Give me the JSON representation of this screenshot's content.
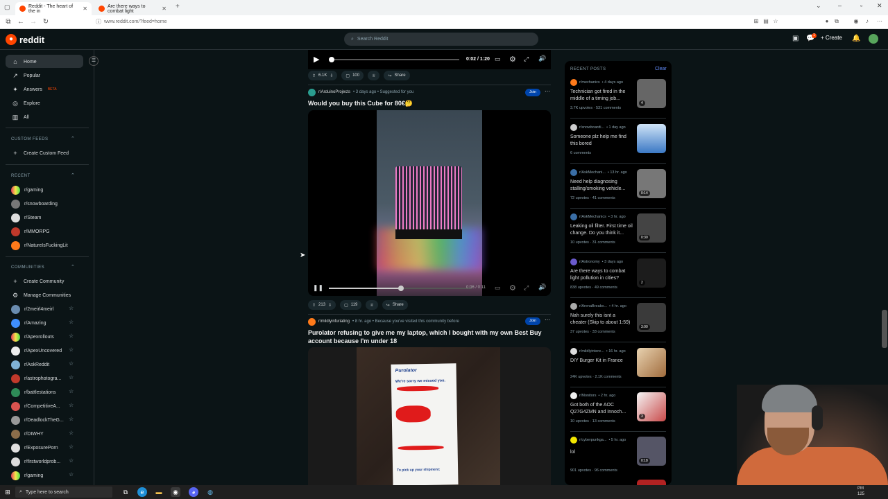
{
  "browser": {
    "tabs": [
      {
        "title": "Reddit - The heart of the in"
      },
      {
        "title": "Are there ways to combat light"
      }
    ],
    "url": "www.reddit.com/?feed=home"
  },
  "header": {
    "logo_text": "reddit",
    "search_placeholder": "Search Reddit",
    "create_label": "Create",
    "notification_count": "1"
  },
  "sidebar": {
    "nav": [
      "Home",
      "Popular",
      "Answers",
      "Explore",
      "All"
    ],
    "answers_badge": "BETA",
    "custom_feeds_heading": "CUSTOM FEEDS",
    "create_custom_feed": "Create Custom Feed",
    "recent_heading": "RECENT",
    "recent": [
      "r/gaming",
      "r/snowboarding",
      "r/Steam",
      "r/MMORPG",
      "r/NatureIsFuckingLit"
    ],
    "communities_heading": "COMMUNITIES",
    "create_community": "Create Community",
    "manage_communities": "Manage Communities",
    "communities": [
      "r/2meirl4meirl",
      "r/Amazing",
      "r/Apexrollouts",
      "r/ApexUncovered",
      "r/AskReddit",
      "r/astrophotogra...",
      "r/battlestations",
      "r/CompetitiveA...",
      "r/DeadlockTheG...",
      "r/DIWHY",
      "r/ExposurePorn",
      "r/firstworldprob...",
      "r/gaming"
    ]
  },
  "top_video": {
    "time": "0:02 / 1:20",
    "upvotes": "6.1K",
    "comments": "100",
    "share": "Share"
  },
  "post1": {
    "subreddit": "r/ArduinoProjects",
    "meta": "• 3 days ago • Suggested for you",
    "join": "Join",
    "title": "Would you buy this Cube for 80€🤔",
    "video_time": "0:06 / 0:11",
    "upvotes": "213",
    "comments": "119",
    "share": "Share"
  },
  "post2": {
    "subreddit": "r/mildlyinfuriating",
    "meta": "• 8 hr. ago • Because you've visited this community before",
    "join": "Join",
    "title": "Purolator refusing to give me my laptop, which I bought with my own Best Buy account because I'm under 18",
    "brand": "Purolator",
    "sorry": "We're sorry we missed you.",
    "pickup": "To pick up your shipment:"
  },
  "recent_posts": {
    "heading": "RECENT POSTS",
    "clear": "Clear",
    "items": [
      {
        "sub": "r/mechanics",
        "age": "• 4 days ago",
        "title": "Technician got fired in the middle of a timing job...",
        "stats": "3.7K upvotes · 531 comments",
        "badge": "4"
      },
      {
        "sub": "r/snowboardi...",
        "age": "• 1 day ago",
        "title": "Someone plz help me find this bored",
        "stats": "6 comments",
        "badge": ""
      },
      {
        "sub": "r/AskMechani...",
        "age": "• 13 hr. ago",
        "title": "Need help diagnosing stalling/smoking vehicle...",
        "stats": "72 upvotes · 41 comments",
        "badge": "0:14"
      },
      {
        "sub": "r/AskMechanics",
        "age": "• 3 hr. ago",
        "title": "Leaking oil filter. First time oil change. Do you think it...",
        "stats": "10 upvotes · 31 comments",
        "badge": "0:30"
      },
      {
        "sub": "r/Astronomy",
        "age": "• 3 days ago",
        "title": "Are there ways to combat light pollution in cities?",
        "stats": "838 upvotes · 49 comments",
        "badge": "2"
      },
      {
        "sub": "r/ArenaBreako...",
        "age": "• 4 hr. ago",
        "title": "Nah surely this isnt a cheater (Skip to about 1:59)",
        "stats": "37 upvotes · 33 comments",
        "badge": "3:00"
      },
      {
        "sub": "r/mildlyintere...",
        "age": "• 16 hr. ago",
        "title": "DIY Burger Kit in France",
        "stats": "24K upvotes · 2.1K comments",
        "badge": ""
      },
      {
        "sub": "r/Monitors",
        "age": "• 2 hr. ago",
        "title": "Got both of the AOC Q27G4ZMN and Innoch...",
        "stats": "10 upvotes · 13 comments",
        "badge": "3"
      },
      {
        "sub": "r/cyberpunkga...",
        "age": "• 5 hr. ago",
        "title": "lol",
        "stats": "901 upvotes · 96 comments",
        "badge": "0:18"
      }
    ]
  },
  "taskbar": {
    "search_placeholder": "Type here to search",
    "clock_top": "PM",
    "clock_bottom": "125"
  },
  "colors": {
    "reddit_orange": "#ff4500",
    "join_blue": "#0045ac",
    "background": "#0b1416"
  }
}
